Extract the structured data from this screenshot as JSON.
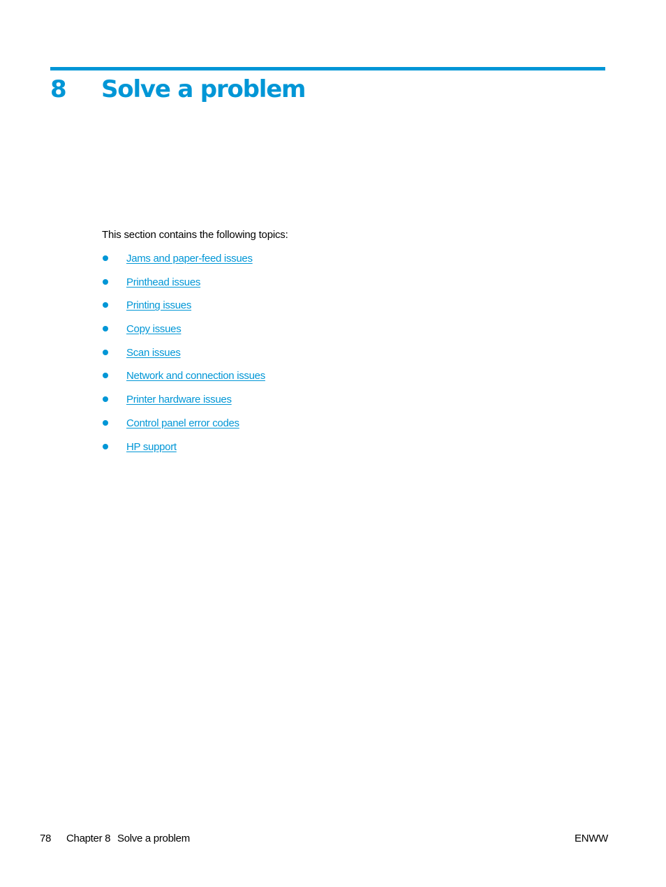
{
  "chapter": {
    "number": "8",
    "title": "Solve a problem"
  },
  "intro": "This section contains the following topics:",
  "topics": [
    {
      "label": "Jams and paper-feed issues"
    },
    {
      "label": "Printhead issues"
    },
    {
      "label": "Printing issues"
    },
    {
      "label": "Copy issues"
    },
    {
      "label": "Scan issues"
    },
    {
      "label": "Network and connection issues"
    },
    {
      "label": "Printer hardware issues"
    },
    {
      "label": "Control panel error codes"
    },
    {
      "label": "HP support"
    }
  ],
  "footer": {
    "page_number": "78",
    "chapter_label": "Chapter 8",
    "chapter_title": "Solve a problem",
    "locale": "ENWW"
  },
  "colors": {
    "accent": "#0096d6"
  }
}
